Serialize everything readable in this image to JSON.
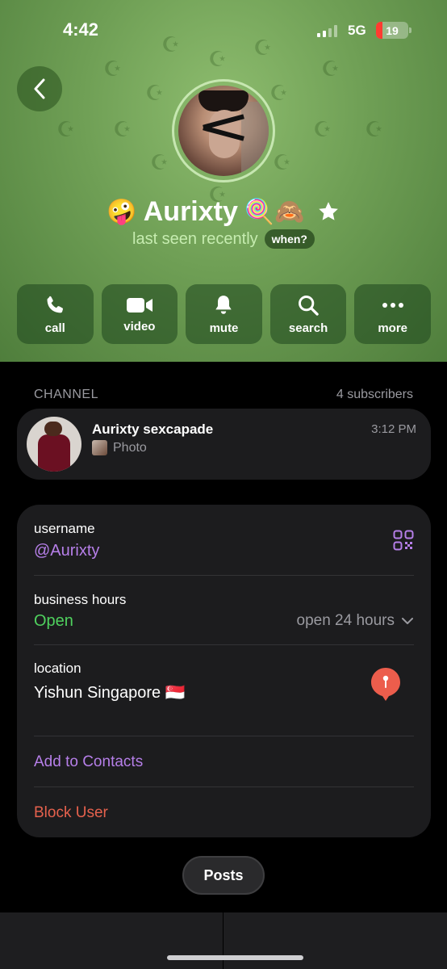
{
  "status_bar": {
    "time": "4:42",
    "network": "5G",
    "battery": "19",
    "battery_level_percent": 19
  },
  "profile": {
    "emoji_prefix": "🤪",
    "name": "Aurixty",
    "emoji_suffix": "🍭🙈",
    "last_seen": "last seen recently",
    "when_label": "when?",
    "background_color": "#6f9f55"
  },
  "actions": [
    {
      "label": "call",
      "icon": "phone-icon"
    },
    {
      "label": "video",
      "icon": "video-camera-icon"
    },
    {
      "label": "mute",
      "icon": "bell-icon"
    },
    {
      "label": "search",
      "icon": "search-icon"
    },
    {
      "label": "more",
      "icon": "more-dots-icon"
    }
  ],
  "channel": {
    "section_label": "CHANNEL",
    "subscribers": "4 subscribers",
    "title": "Aurixty sexcapade",
    "time": "3:12 PM",
    "preview": "Photo"
  },
  "info": {
    "username_label": "username",
    "username_value": "@Aurixty",
    "hours_label": "business hours",
    "hours_status": "Open",
    "hours_detail": "open 24 hours",
    "location_label": "location",
    "location_value": "Yishun Singapore 🇸🇬",
    "add_contacts": "Add to Contacts",
    "block_user": "Block User"
  },
  "colors": {
    "accent_purple": "#b67fe9",
    "open_green": "#4fd15e",
    "danger_red": "#e5614d",
    "pin_red": "#ec5d4c"
  },
  "posts_button": "Posts"
}
